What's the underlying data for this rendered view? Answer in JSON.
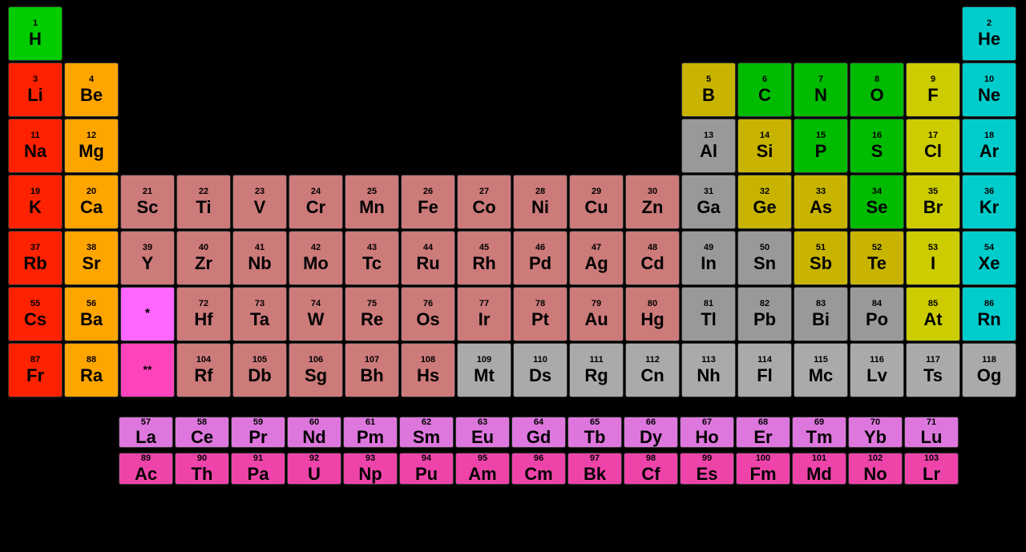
{
  "elements": [
    {
      "num": 1,
      "sym": "H",
      "col": 1,
      "row": 1,
      "type": "h-color"
    },
    {
      "num": 2,
      "sym": "He",
      "col": 18,
      "row": 1,
      "type": "noble"
    },
    {
      "num": 3,
      "sym": "Li",
      "col": 1,
      "row": 2,
      "type": "alkali"
    },
    {
      "num": 4,
      "sym": "Be",
      "col": 2,
      "row": 2,
      "type": "alkaline"
    },
    {
      "num": 5,
      "sym": "B",
      "col": 13,
      "row": 2,
      "type": "metalloid"
    },
    {
      "num": 6,
      "sym": "C",
      "col": 14,
      "row": 2,
      "type": "nonmetal"
    },
    {
      "num": 7,
      "sym": "N",
      "col": 15,
      "row": 2,
      "type": "nonmetal"
    },
    {
      "num": 8,
      "sym": "O",
      "col": 16,
      "row": 2,
      "type": "nonmetal"
    },
    {
      "num": 9,
      "sym": "F",
      "col": 17,
      "row": 2,
      "type": "halogen"
    },
    {
      "num": 10,
      "sym": "Ne",
      "col": 18,
      "row": 2,
      "type": "noble"
    },
    {
      "num": 11,
      "sym": "Na",
      "col": 1,
      "row": 3,
      "type": "alkali"
    },
    {
      "num": 12,
      "sym": "Mg",
      "col": 2,
      "row": 3,
      "type": "alkaline"
    },
    {
      "num": 13,
      "sym": "Al",
      "col": 13,
      "row": 3,
      "type": "post-transition"
    },
    {
      "num": 14,
      "sym": "Si",
      "col": 14,
      "row": 3,
      "type": "metalloid"
    },
    {
      "num": 15,
      "sym": "P",
      "col": 15,
      "row": 3,
      "type": "nonmetal"
    },
    {
      "num": 16,
      "sym": "S",
      "col": 16,
      "row": 3,
      "type": "nonmetal"
    },
    {
      "num": 17,
      "sym": "Cl",
      "col": 17,
      "row": 3,
      "type": "halogen"
    },
    {
      "num": 18,
      "sym": "Ar",
      "col": 18,
      "row": 3,
      "type": "noble"
    },
    {
      "num": 19,
      "sym": "K",
      "col": 1,
      "row": 4,
      "type": "alkali"
    },
    {
      "num": 20,
      "sym": "Ca",
      "col": 2,
      "row": 4,
      "type": "alkaline"
    },
    {
      "num": 21,
      "sym": "Sc",
      "col": 3,
      "row": 4,
      "type": "transition"
    },
    {
      "num": 22,
      "sym": "Ti",
      "col": 4,
      "row": 4,
      "type": "transition"
    },
    {
      "num": 23,
      "sym": "V",
      "col": 5,
      "row": 4,
      "type": "transition"
    },
    {
      "num": 24,
      "sym": "Cr",
      "col": 6,
      "row": 4,
      "type": "transition"
    },
    {
      "num": 25,
      "sym": "Mn",
      "col": 7,
      "row": 4,
      "type": "transition"
    },
    {
      "num": 26,
      "sym": "Fe",
      "col": 8,
      "row": 4,
      "type": "transition"
    },
    {
      "num": 27,
      "sym": "Co",
      "col": 9,
      "row": 4,
      "type": "transition"
    },
    {
      "num": 28,
      "sym": "Ni",
      "col": 10,
      "row": 4,
      "type": "transition"
    },
    {
      "num": 29,
      "sym": "Cu",
      "col": 11,
      "row": 4,
      "type": "transition"
    },
    {
      "num": 30,
      "sym": "Zn",
      "col": 12,
      "row": 4,
      "type": "transition"
    },
    {
      "num": 31,
      "sym": "Ga",
      "col": 13,
      "row": 4,
      "type": "post-transition"
    },
    {
      "num": 32,
      "sym": "Ge",
      "col": 14,
      "row": 4,
      "type": "metalloid"
    },
    {
      "num": 33,
      "sym": "As",
      "col": 15,
      "row": 4,
      "type": "metalloid"
    },
    {
      "num": 34,
      "sym": "Se",
      "col": 16,
      "row": 4,
      "type": "nonmetal"
    },
    {
      "num": 35,
      "sym": "Br",
      "col": 17,
      "row": 4,
      "type": "halogen"
    },
    {
      "num": 36,
      "sym": "Kr",
      "col": 18,
      "row": 4,
      "type": "noble"
    },
    {
      "num": 37,
      "sym": "Rb",
      "col": 1,
      "row": 5,
      "type": "alkali"
    },
    {
      "num": 38,
      "sym": "Sr",
      "col": 2,
      "row": 5,
      "type": "alkaline"
    },
    {
      "num": 39,
      "sym": "Y",
      "col": 3,
      "row": 5,
      "type": "transition"
    },
    {
      "num": 40,
      "sym": "Zr",
      "col": 4,
      "row": 5,
      "type": "transition"
    },
    {
      "num": 41,
      "sym": "Nb",
      "col": 5,
      "row": 5,
      "type": "transition"
    },
    {
      "num": 42,
      "sym": "Mo",
      "col": 6,
      "row": 5,
      "type": "transition"
    },
    {
      "num": 43,
      "sym": "Tc",
      "col": 7,
      "row": 5,
      "type": "transition"
    },
    {
      "num": 44,
      "sym": "Ru",
      "col": 8,
      "row": 5,
      "type": "transition"
    },
    {
      "num": 45,
      "sym": "Rh",
      "col": 9,
      "row": 5,
      "type": "transition"
    },
    {
      "num": 46,
      "sym": "Pd",
      "col": 10,
      "row": 5,
      "type": "transition"
    },
    {
      "num": 47,
      "sym": "Ag",
      "col": 11,
      "row": 5,
      "type": "transition"
    },
    {
      "num": 48,
      "sym": "Cd",
      "col": 12,
      "row": 5,
      "type": "transition"
    },
    {
      "num": 49,
      "sym": "In",
      "col": 13,
      "row": 5,
      "type": "post-transition"
    },
    {
      "num": 50,
      "sym": "Sn",
      "col": 14,
      "row": 5,
      "type": "post-transition"
    },
    {
      "num": 51,
      "sym": "Sb",
      "col": 15,
      "row": 5,
      "type": "metalloid"
    },
    {
      "num": 52,
      "sym": "Te",
      "col": 16,
      "row": 5,
      "type": "metalloid"
    },
    {
      "num": 53,
      "sym": "I",
      "col": 17,
      "row": 5,
      "type": "halogen"
    },
    {
      "num": 54,
      "sym": "Xe",
      "col": 18,
      "row": 5,
      "type": "noble"
    },
    {
      "num": 55,
      "sym": "Cs",
      "col": 1,
      "row": 6,
      "type": "alkali"
    },
    {
      "num": 56,
      "sym": "Ba",
      "col": 2,
      "row": 6,
      "type": "alkaline"
    },
    {
      "num": 72,
      "sym": "Hf",
      "col": 4,
      "row": 6,
      "type": "transition"
    },
    {
      "num": 73,
      "sym": "Ta",
      "col": 5,
      "row": 6,
      "type": "transition"
    },
    {
      "num": 74,
      "sym": "W",
      "col": 6,
      "row": 6,
      "type": "transition"
    },
    {
      "num": 75,
      "sym": "Re",
      "col": 7,
      "row": 6,
      "type": "transition"
    },
    {
      "num": 76,
      "sym": "Os",
      "col": 8,
      "row": 6,
      "type": "transition"
    },
    {
      "num": 77,
      "sym": "Ir",
      "col": 9,
      "row": 6,
      "type": "transition"
    },
    {
      "num": 78,
      "sym": "Pt",
      "col": 10,
      "row": 6,
      "type": "transition"
    },
    {
      "num": 79,
      "sym": "Au",
      "col": 11,
      "row": 6,
      "type": "transition"
    },
    {
      "num": 80,
      "sym": "Hg",
      "col": 12,
      "row": 6,
      "type": "transition"
    },
    {
      "num": 81,
      "sym": "Tl",
      "col": 13,
      "row": 6,
      "type": "post-transition"
    },
    {
      "num": 82,
      "sym": "Pb",
      "col": 14,
      "row": 6,
      "type": "post-transition"
    },
    {
      "num": 83,
      "sym": "Bi",
      "col": 15,
      "row": 6,
      "type": "post-transition"
    },
    {
      "num": 84,
      "sym": "Po",
      "col": 16,
      "row": 6,
      "type": "post-transition"
    },
    {
      "num": 85,
      "sym": "At",
      "col": 17,
      "row": 6,
      "type": "halogen"
    },
    {
      "num": 86,
      "sym": "Rn",
      "col": 18,
      "row": 6,
      "type": "noble"
    },
    {
      "num": 87,
      "sym": "Fr",
      "col": 1,
      "row": 7,
      "type": "alkali"
    },
    {
      "num": 88,
      "sym": "Ra",
      "col": 2,
      "row": 7,
      "type": "alkaline"
    },
    {
      "num": 104,
      "sym": "Rf",
      "col": 4,
      "row": 7,
      "type": "transition"
    },
    {
      "num": 105,
      "sym": "Db",
      "col": 5,
      "row": 7,
      "type": "transition"
    },
    {
      "num": 106,
      "sym": "Sg",
      "col": 6,
      "row": 7,
      "type": "transition"
    },
    {
      "num": 107,
      "sym": "Bh",
      "col": 7,
      "row": 7,
      "type": "transition"
    },
    {
      "num": 108,
      "sym": "Hs",
      "col": 8,
      "row": 7,
      "type": "transition"
    },
    {
      "num": 109,
      "sym": "Mt",
      "col": 9,
      "row": 7,
      "type": "unknown"
    },
    {
      "num": 110,
      "sym": "Ds",
      "col": 10,
      "row": 7,
      "type": "unknown"
    },
    {
      "num": 111,
      "sym": "Rg",
      "col": 11,
      "row": 7,
      "type": "unknown"
    },
    {
      "num": 112,
      "sym": "Cn",
      "col": 12,
      "row": 7,
      "type": "unknown"
    },
    {
      "num": 113,
      "sym": "Nh",
      "col": 13,
      "row": 7,
      "type": "unknown"
    },
    {
      "num": 114,
      "sym": "Fl",
      "col": 14,
      "row": 7,
      "type": "unknown"
    },
    {
      "num": 115,
      "sym": "Mc",
      "col": 15,
      "row": 7,
      "type": "unknown"
    },
    {
      "num": 116,
      "sym": "Lv",
      "col": 16,
      "row": 7,
      "type": "unknown"
    },
    {
      "num": 117,
      "sym": "Ts",
      "col": 17,
      "row": 7,
      "type": "unknown"
    },
    {
      "num": 118,
      "sym": "Og",
      "col": 18,
      "row": 7,
      "type": "unknown"
    }
  ],
  "la_placeholder": {
    "row": 6,
    "col": 3,
    "label": "*"
  },
  "ac_placeholder": {
    "row": 7,
    "col": 3,
    "label": "**"
  },
  "lanthanides": [
    {
      "num": 57,
      "sym": "La",
      "type": "lanthanide"
    },
    {
      "num": 58,
      "sym": "Ce",
      "type": "lanthanide"
    },
    {
      "num": 59,
      "sym": "Pr",
      "type": "lanthanide"
    },
    {
      "num": 60,
      "sym": "Nd",
      "type": "lanthanide"
    },
    {
      "num": 61,
      "sym": "Pm",
      "type": "lanthanide"
    },
    {
      "num": 62,
      "sym": "Sm",
      "type": "lanthanide"
    },
    {
      "num": 63,
      "sym": "Eu",
      "type": "lanthanide"
    },
    {
      "num": 64,
      "sym": "Gd",
      "type": "lanthanide"
    },
    {
      "num": 65,
      "sym": "Tb",
      "type": "lanthanide"
    },
    {
      "num": 66,
      "sym": "Dy",
      "type": "lanthanide"
    },
    {
      "num": 67,
      "sym": "Ho",
      "type": "lanthanide"
    },
    {
      "num": 68,
      "sym": "Er",
      "type": "lanthanide"
    },
    {
      "num": 69,
      "sym": "Tm",
      "type": "lanthanide"
    },
    {
      "num": 70,
      "sym": "Yb",
      "type": "lanthanide"
    },
    {
      "num": 71,
      "sym": "Lu",
      "type": "lanthanide"
    }
  ],
  "actinides": [
    {
      "num": 89,
      "sym": "Ac",
      "type": "actinide"
    },
    {
      "num": 90,
      "sym": "Th",
      "type": "actinide"
    },
    {
      "num": 91,
      "sym": "Pa",
      "type": "actinide"
    },
    {
      "num": 92,
      "sym": "U",
      "type": "actinide"
    },
    {
      "num": 93,
      "sym": "Np",
      "type": "actinide"
    },
    {
      "num": 94,
      "sym": "Pu",
      "type": "actinide"
    },
    {
      "num": 95,
      "sym": "Am",
      "type": "actinide"
    },
    {
      "num": 96,
      "sym": "Cm",
      "type": "actinide"
    },
    {
      "num": 97,
      "sym": "Bk",
      "type": "actinide"
    },
    {
      "num": 98,
      "sym": "Cf",
      "type": "actinide"
    },
    {
      "num": 99,
      "sym": "Es",
      "type": "actinide"
    },
    {
      "num": 100,
      "sym": "Fm",
      "type": "actinide"
    },
    {
      "num": 101,
      "sym": "Md",
      "type": "actinide"
    },
    {
      "num": 102,
      "sym": "No",
      "type": "actinide"
    },
    {
      "num": 103,
      "sym": "Lr",
      "type": "actinide"
    }
  ]
}
